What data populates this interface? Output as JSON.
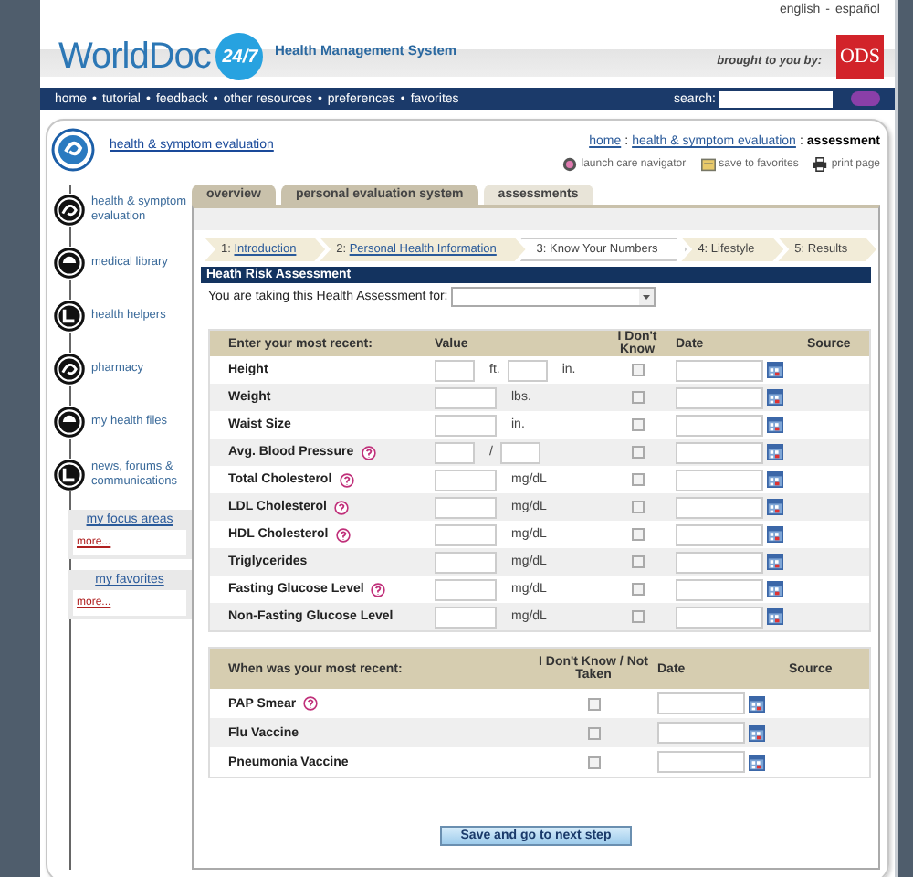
{
  "language_links": [
    {
      "label": "english"
    },
    {
      "label": "español"
    }
  ],
  "language_separator": "-",
  "logo": {
    "text": "WorldDoc",
    "badge": "24/7",
    "tagline": "Health Management System"
  },
  "sponsor": {
    "label": "brought to you by:",
    "logo": "ODS"
  },
  "nav": {
    "items": [
      {
        "label": "home"
      },
      {
        "label": "tutorial"
      },
      {
        "label": "feedback"
      },
      {
        "label": "other resources"
      },
      {
        "label": "preferences"
      },
      {
        "label": "favorites"
      }
    ],
    "separator": "•",
    "search_label": "search:"
  },
  "section": {
    "title": "health & symptom evaluation",
    "breadcrumb": [
      {
        "label": "home",
        "link": true
      },
      {
        "label": "health & symptom evaluation",
        "link": true
      },
      {
        "label": "assessment",
        "link": false
      }
    ],
    "breadcrumb_separator": ":",
    "actions": [
      {
        "kind": "navigator",
        "label": "launch care navigator"
      },
      {
        "kind": "favorites",
        "label": "save to favorites"
      },
      {
        "kind": "print",
        "label": "print page"
      }
    ]
  },
  "sidebar": {
    "items": [
      {
        "label": "health & symptom evaluation"
      },
      {
        "label": "medical library"
      },
      {
        "label": "health helpers"
      },
      {
        "label": "pharmacy"
      },
      {
        "label": "my health files"
      },
      {
        "label": "news, forums & communications"
      }
    ],
    "boxes": [
      {
        "title": "my focus areas",
        "link": "more..."
      },
      {
        "title": "my favorites",
        "link": "more..."
      }
    ]
  },
  "tabs": [
    {
      "label": "overview",
      "selected": false
    },
    {
      "label": "personal evaluation system",
      "selected": false
    },
    {
      "label": "assessments",
      "selected": true
    }
  ],
  "steps": [
    {
      "number": "1:",
      "label": "Introduction",
      "completed": true,
      "selected": false
    },
    {
      "number": "2:",
      "label": "Personal Health Information",
      "completed": true,
      "selected": false
    },
    {
      "number": "3:",
      "label": "Know Your Numbers",
      "completed": false,
      "selected": true
    },
    {
      "number": "4:",
      "label": "Lifestyle",
      "completed": false,
      "selected": false
    },
    {
      "number": "5:",
      "label": "Results",
      "completed": false,
      "selected": false
    }
  ],
  "panel_title": "Heath Risk Assessment",
  "subject_prompt": "You are taking this Health Assessment for:",
  "measures": {
    "columns": [
      "Enter your most recent:",
      "Value",
      "I Don't Know",
      "Date",
      "Source"
    ],
    "rows": [
      {
        "label": "Height",
        "help": false,
        "kind": "pair",
        "units": [
          "ft.",
          "in."
        ],
        "checked": false
      },
      {
        "label": "Weight",
        "help": false,
        "kind": "single",
        "units": [
          "lbs."
        ],
        "checked": false
      },
      {
        "label": "Waist Size",
        "help": false,
        "kind": "single",
        "units": [
          "in."
        ],
        "checked": false
      },
      {
        "label": "Avg. Blood Pressure",
        "help": true,
        "kind": "ratio",
        "units": [
          "/"
        ],
        "checked": false
      },
      {
        "label": "Total Cholesterol",
        "help": true,
        "kind": "single",
        "units": [
          "mg/dL"
        ],
        "checked": false
      },
      {
        "label": "LDL Cholesterol",
        "help": true,
        "kind": "single",
        "units": [
          "mg/dL"
        ],
        "checked": false
      },
      {
        "label": "HDL Cholesterol",
        "help": true,
        "kind": "single",
        "units": [
          "mg/dL"
        ],
        "checked": false
      },
      {
        "label": "Triglycerides",
        "help": false,
        "kind": "single",
        "units": [
          "mg/dL"
        ],
        "checked": false
      },
      {
        "label": "Fasting Glucose Level",
        "help": true,
        "kind": "single",
        "units": [
          "mg/dL"
        ],
        "checked": false
      },
      {
        "label": "Non-Fasting Glucose Level",
        "help": false,
        "kind": "single",
        "units": [
          "mg/dL"
        ],
        "checked": false
      }
    ]
  },
  "screenings": {
    "columns": [
      "When was your most recent:",
      "I Don't Know / Not Taken",
      "Date",
      "Source"
    ],
    "rows": [
      {
        "label": "PAP Smear",
        "help": true,
        "checked": false
      },
      {
        "label": "Flu Vaccine",
        "help": false,
        "checked": false
      },
      {
        "label": "Pneumonia Vaccine",
        "help": false,
        "checked": false
      }
    ]
  },
  "submit_button": "Save and go to next step"
}
